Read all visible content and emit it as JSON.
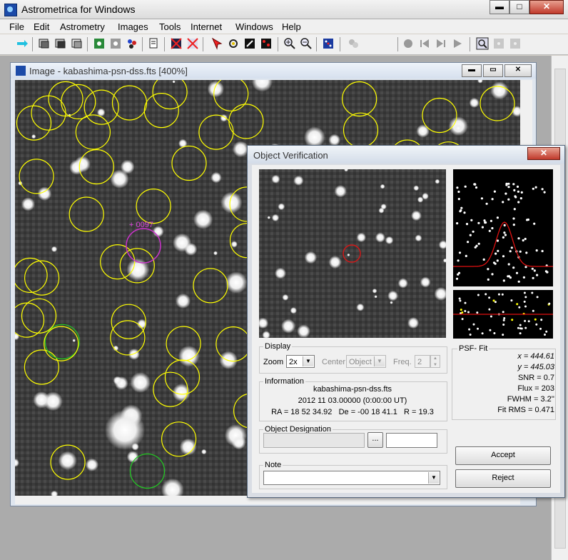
{
  "window": {
    "title": "Astrometrica for Windows",
    "min": "▬",
    "max": "□",
    "close": "✕"
  },
  "menu": [
    "File",
    "Edit",
    "Astrometry",
    "Images",
    "Tools",
    "Internet",
    "Windows",
    "Help"
  ],
  "toolbar": {
    "spin_value": "2"
  },
  "image_window": {
    "title": "Image - kabashima-psn-dss.fts [400%]"
  },
  "dialog": {
    "title": "Object Verification",
    "close": "✕",
    "display": {
      "label": "Display",
      "zoom_label": "Zoom",
      "zoom_value": "2x",
      "center_label": "Center",
      "center_value": "Object",
      "freq_label": "Freq.",
      "freq_value": "2"
    },
    "information": {
      "label": "Information",
      "file": "kabashima-psn-dss.fts",
      "date": "2012 11 03.00000 (0:00:00 UT)",
      "coords": "RA = 18 52 34.92   De = -00 18 41.1   R = 19.3"
    },
    "designation": {
      "label": "Object Designation",
      "browse": "..."
    },
    "note": {
      "label": "Note"
    },
    "psf": {
      "label": "PSF- Fit",
      "x": "x = 444.61",
      "y": "y = 445.03",
      "snr": "SNR = 0.7",
      "flux": "Flux = 203",
      "fwhm": "FWHM = 3.2''",
      "rms": "Fit RMS = 0.471"
    },
    "accept": "Accept",
    "reject": "Reject"
  },
  "colors": {
    "reference_circle": "#ffff00",
    "known_object_circle": "#22cc22",
    "target_circle": "#cc33cc",
    "psf_curve": "#e01010"
  }
}
